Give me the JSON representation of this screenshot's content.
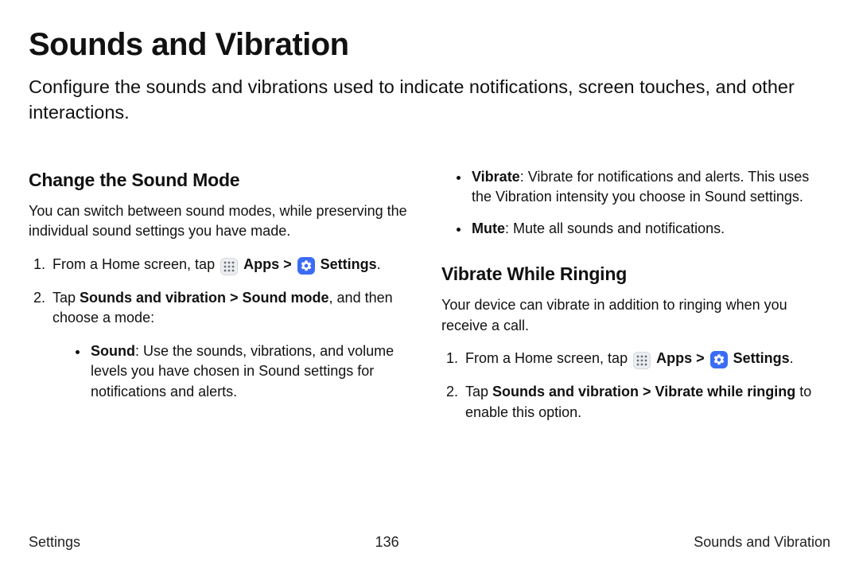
{
  "title": "Sounds and Vibration",
  "intro": "Configure the sounds and vibrations used to indicate notifications, screen touches, and other interactions.",
  "col1": {
    "heading": "Change the Sound Mode",
    "para": "You can switch between sound modes, while preserving the individual sound settings you have made.",
    "step1_pre": "From a Home screen, tap ",
    "apps_label": "Apps",
    "sep": " > ",
    "settings_label": "Settings",
    "period": ".",
    "step2_pre": "Tap ",
    "step2_bold": "Sounds and vibration > Sound mode",
    "step2_post": ", and then choose a mode:",
    "bullet1_bold": "Sound",
    "bullet1_rest": ": Use the sounds, vibrations, and volume levels you have chosen in Sound settings for notifications and alerts."
  },
  "col2": {
    "bullet_vibrate_bold": "Vibrate",
    "bullet_vibrate_rest": ": Vibrate for notifications and alerts. This uses the Vibration intensity you choose in Sound settings.",
    "bullet_mute_bold": "Mute",
    "bullet_mute_rest": ": Mute all sounds and notifications.",
    "heading": "Vibrate While Ringing",
    "para": "Your device can vibrate in addition to ringing when you receive a call.",
    "step1_pre": "From a Home screen, tap ",
    "apps_label": "Apps",
    "sep": " > ",
    "settings_label": "Settings",
    "period": ".",
    "step2_pre": "Tap ",
    "step2_bold": "Sounds and vibration > Vibrate while ringing",
    "step2_post": " to enable this option."
  },
  "footer": {
    "left": "Settings",
    "center": "136",
    "right": "Sounds and Vibration"
  }
}
